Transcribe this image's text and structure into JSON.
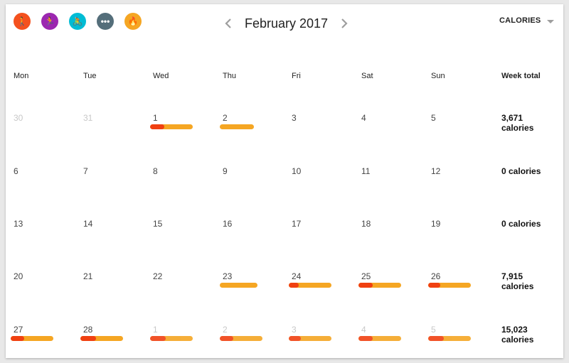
{
  "activities": [
    {
      "name": "walking-icon",
      "color": "#f4511e",
      "glyph": "🚶"
    },
    {
      "name": "running-icon",
      "color": "#9c27b0",
      "glyph": "🏃"
    },
    {
      "name": "biking-icon",
      "color": "#00bcd4",
      "glyph": "🚴"
    },
    {
      "name": "other-activities-icon",
      "color": "#546e7a",
      "glyph": "•••"
    },
    {
      "name": "calories-flame-icon",
      "color": "#f5a623",
      "glyph": "🔥"
    }
  ],
  "nav": {
    "month_label": "February 2017"
  },
  "metric": {
    "selected": "CALORIES"
  },
  "headers": [
    "Mon",
    "Tue",
    "Wed",
    "Thu",
    "Fri",
    "Sat",
    "Sun",
    "Week total"
  ],
  "weeks": [
    {
      "days": [
        {
          "n": "30",
          "faded": true
        },
        {
          "n": "31",
          "faded": true
        },
        {
          "n": "1",
          "bar": [
            60,
            20
          ]
        },
        {
          "n": "2",
          "bar": [
            48,
            0
          ]
        },
        {
          "n": "3"
        },
        {
          "n": "4"
        },
        {
          "n": "5"
        }
      ],
      "total_value": "3,671",
      "total_unit": "calories"
    },
    {
      "days": [
        {
          "n": "6"
        },
        {
          "n": "7"
        },
        {
          "n": "8"
        },
        {
          "n": "9"
        },
        {
          "n": "10"
        },
        {
          "n": "11"
        },
        {
          "n": "12"
        }
      ],
      "total_value": "0 calories",
      "total_unit": ""
    },
    {
      "days": [
        {
          "n": "13"
        },
        {
          "n": "14"
        },
        {
          "n": "15"
        },
        {
          "n": "16"
        },
        {
          "n": "17"
        },
        {
          "n": "18"
        },
        {
          "n": "19"
        }
      ],
      "total_value": "0 calories",
      "total_unit": ""
    },
    {
      "days": [
        {
          "n": "20"
        },
        {
          "n": "21"
        },
        {
          "n": "22"
        },
        {
          "n": "23",
          "bar": [
            53,
            0
          ]
        },
        {
          "n": "24",
          "bar": [
            60,
            14
          ]
        },
        {
          "n": "25",
          "bar": [
            60,
            20
          ]
        },
        {
          "n": "26",
          "bar": [
            60,
            17
          ]
        }
      ],
      "total_value": "7,915",
      "total_unit": "calories"
    },
    {
      "days": [
        {
          "n": "27",
          "bar": [
            60,
            19
          ]
        },
        {
          "n": "28",
          "bar": [
            60,
            22
          ]
        },
        {
          "n": "1",
          "faded": true,
          "bar": [
            60,
            22
          ]
        },
        {
          "n": "2",
          "faded": true,
          "bar": [
            60,
            19
          ]
        },
        {
          "n": "3",
          "faded": true,
          "bar": [
            60,
            17
          ]
        },
        {
          "n": "4",
          "faded": true,
          "bar": [
            60,
            20
          ]
        },
        {
          "n": "5",
          "faded": true,
          "bar": [
            60,
            22
          ]
        }
      ],
      "total_value": "15,023",
      "total_unit": "calories"
    }
  ]
}
